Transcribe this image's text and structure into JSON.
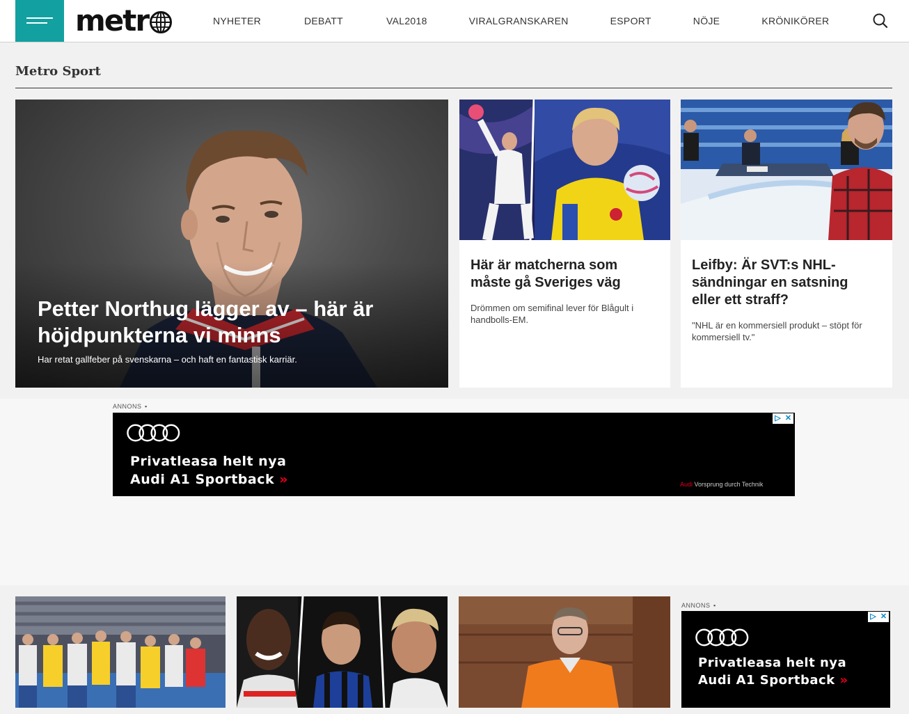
{
  "header": {
    "logo_text": "metr",
    "nav": [
      "NYHETER",
      "DEBATT",
      "VAL2018",
      "VIRALGRANSKAREN",
      "ESPORT",
      "NÖJE",
      "KRÖNIKÖRER"
    ]
  },
  "section": {
    "title": "Metro Sport"
  },
  "hero": {
    "title": "Petter Northug lägger av – här är höjdpunkterna vi minns",
    "subtitle": "Har retat gallfeber på svenskarna – och haft en fantastisk karriär."
  },
  "cards": [
    {
      "title": "Här är matcherna som måste gå Sveriges väg",
      "subtitle": "Drömmen om semifinal lever för Blågult i handbolls-EM."
    },
    {
      "title": "Leifby: Är SVT:s NHL-sändningar en satsning eller ett straff?",
      "subtitle": "\"NHL är en kommersiell produkt – stöpt för kommersiell tv.\""
    }
  ],
  "ads": [
    {
      "label": "ANNONS",
      "line1": "Privatleasa helt nya",
      "line2": "Audi A1 Sportback",
      "chevron": "»",
      "brand": "Audi",
      "claim": "Vorsprung durch Technik"
    },
    {
      "label": "ANNONS",
      "line1": "Privatleasa helt nya",
      "line2": "Audi A1 Sportback",
      "chevron": "»"
    }
  ],
  "colors": {
    "accent": "#13a0a0",
    "audi_red": "#e3001b",
    "ad_bg": "#000000"
  },
  "icons": {
    "menu": "hamburger-icon",
    "search": "search-icon",
    "logo_o": "globe-icon",
    "adchoices": "adchoices-icon"
  }
}
